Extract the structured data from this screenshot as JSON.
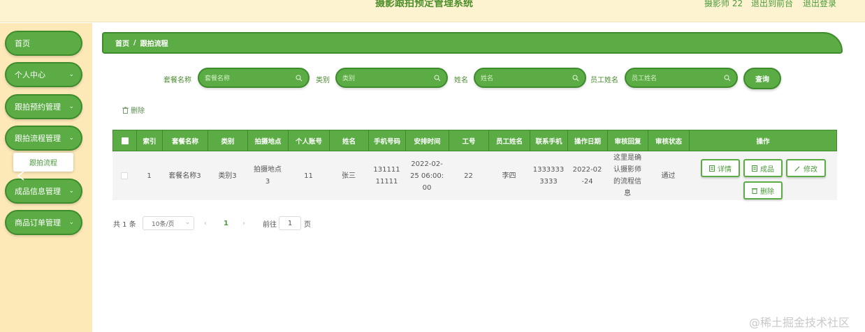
{
  "header": {
    "title": "摄影跟拍预定管理系统",
    "user": "摄影师 22",
    "link_front": "退出到前台",
    "link_logout": "退出登录"
  },
  "sidebar": {
    "items": [
      {
        "label": "首页"
      },
      {
        "label": "个人中心"
      },
      {
        "label": "跟拍预约管理"
      },
      {
        "label": "跟拍流程管理"
      },
      {
        "label": "成品信息管理"
      },
      {
        "label": "商品订单管理"
      }
    ],
    "submenu": "跟拍流程"
  },
  "breadcrumb": {
    "home": "首页",
    "separator": "/",
    "current": "跟拍流程"
  },
  "search": {
    "package_label": "套餐名称",
    "package_placeholder": "套餐名称",
    "category_label": "类别",
    "category_placeholder": "类别",
    "name_label": "姓名",
    "name_placeholder": "姓名",
    "staff_label": "员工姓名",
    "staff_placeholder": "员工姓名",
    "query_button": "查询"
  },
  "toolbar": {
    "delete_label": "删除"
  },
  "table": {
    "headers": [
      "索引",
      "套餐名称",
      "类别",
      "拍摄地点",
      "个人账号",
      "姓名",
      "手机号码",
      "安排时间",
      "工号",
      "员工姓名",
      "联系手机",
      "操作日期",
      "审核回复",
      "审核状态",
      "操作"
    ],
    "rows": [
      {
        "index": "1",
        "package": "套餐名称3",
        "category": "类别3",
        "location": "拍摄地点3",
        "account": "11",
        "name": "张三",
        "phone": "13111111111",
        "schedule": "2022-02-25 06:00:00",
        "staff_no": "22",
        "staff_name": "李四",
        "contact": "13333333333",
        "op_date": "2022-02-24",
        "reply": "这里是确认摄影师的流程信息",
        "status": "通过"
      }
    ],
    "actions": {
      "detail": "详情",
      "product": "成品",
      "edit": "修改",
      "delete": "删除"
    }
  },
  "pagination": {
    "total": "共 1 条",
    "page_size": "10条/页",
    "current_page": "1",
    "goto_label": "前往",
    "goto_value": "1",
    "page_suffix": "页"
  },
  "watermark": "@稀土掘金技术社区",
  "colors": {
    "primary": "#5cac45",
    "primary_border": "#3d8c2c",
    "sidebar_bg": "#fde8b8",
    "header_bg": "#fdf3d0"
  }
}
